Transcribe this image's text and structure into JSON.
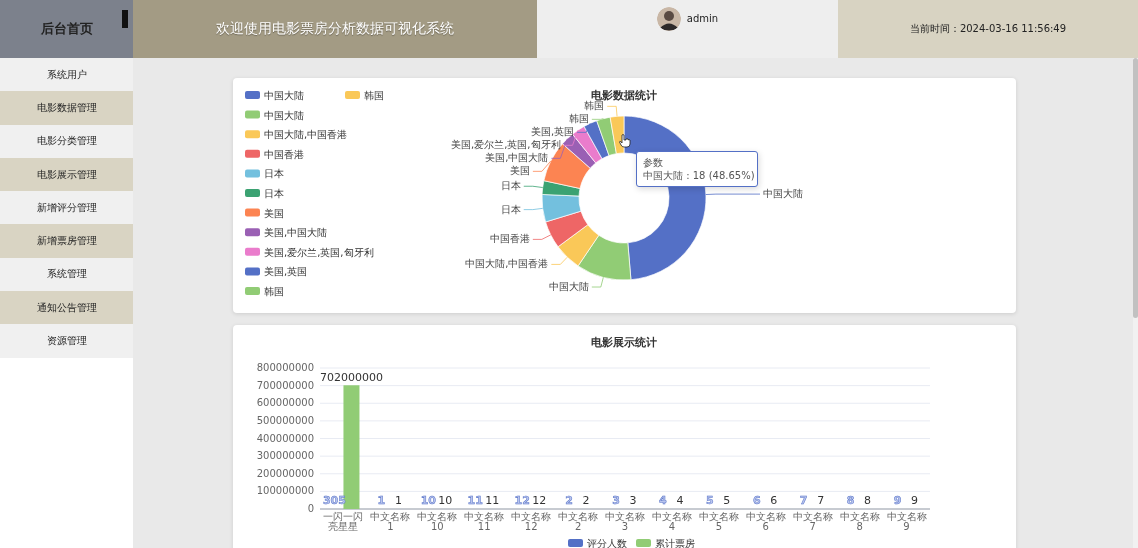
{
  "header": {
    "brand": "后台首页",
    "title": "欢迎使用电影票房分析数据可视化系统",
    "user": "admin",
    "time": "当前时间：2024-03-16 11:56:49"
  },
  "sidebar": {
    "items": [
      "系统用户",
      "电影数据管理",
      "电影分类管理",
      "电影展示管理",
      "新增评分管理",
      "新增票房管理",
      "系统管理",
      "通知公告管理",
      "资源管理"
    ]
  },
  "pie_card": {
    "chart_data": {
      "type": "donut",
      "title": "电影数据统计",
      "categories": [
        "中国大陆",
        "中国大陆",
        "中国大陆,中国香港",
        "中国香港",
        "日本",
        "日本",
        "美国",
        "美国,中国大陆",
        "美国,爱尔兰,英国,匈牙利",
        "美国,英国",
        "韩国",
        "韩国"
      ],
      "series": [
        {
          "name": "参数",
          "values": [
            48.65,
            10.81,
            5.41,
            5.41,
            5.41,
            2.7,
            8.11,
            2.7,
            2.7,
            2.7,
            2.7,
            2.7
          ]
        }
      ],
      "legend": true,
      "colors": [
        "#5470c6",
        "#91cc75",
        "#fac858",
        "#ee6666",
        "#73c0de",
        "#3ba272",
        "#fc8452",
        "#9a60b4",
        "#ea7ccc",
        "#5470c6",
        "#91cc75",
        "#fac858"
      ]
    },
    "tooltip": {
      "text": "中国大陆 : 18 (48.65%)"
    }
  },
  "bar_card": {
    "chart_data": {
      "type": "bar",
      "title": "电影展示统计",
      "categories": [
        "一闪一闪亮星星",
        "中文名称1",
        "中文名称10",
        "中文名称11",
        "中文名称12",
        "中文名称2",
        "中文名称3",
        "中文名称4",
        "中文名称5",
        "中文名称6",
        "中文名称7",
        "中文名称8",
        "中文名称9"
      ],
      "legend": true,
      "grid": true,
      "series": [
        {
          "name": "评分人数",
          "color": "#5470c6",
          "values": [
            305,
            1,
            10,
            11,
            12,
            2,
            3,
            4,
            5,
            6,
            7,
            8,
            9
          ]
        },
        {
          "name": "累计票房",
          "color": "#91cc75",
          "values": [
            702000000,
            1,
            10,
            11,
            12,
            2,
            3,
            4,
            5,
            6,
            7,
            8,
            9
          ]
        }
      ],
      "ylim": [
        0,
        800000000
      ],
      "yticks": [
        0,
        100000000,
        200000000,
        300000000,
        400000000,
        500000000,
        600000000,
        700000000,
        800000000
      ],
      "data_labels": true
    }
  }
}
